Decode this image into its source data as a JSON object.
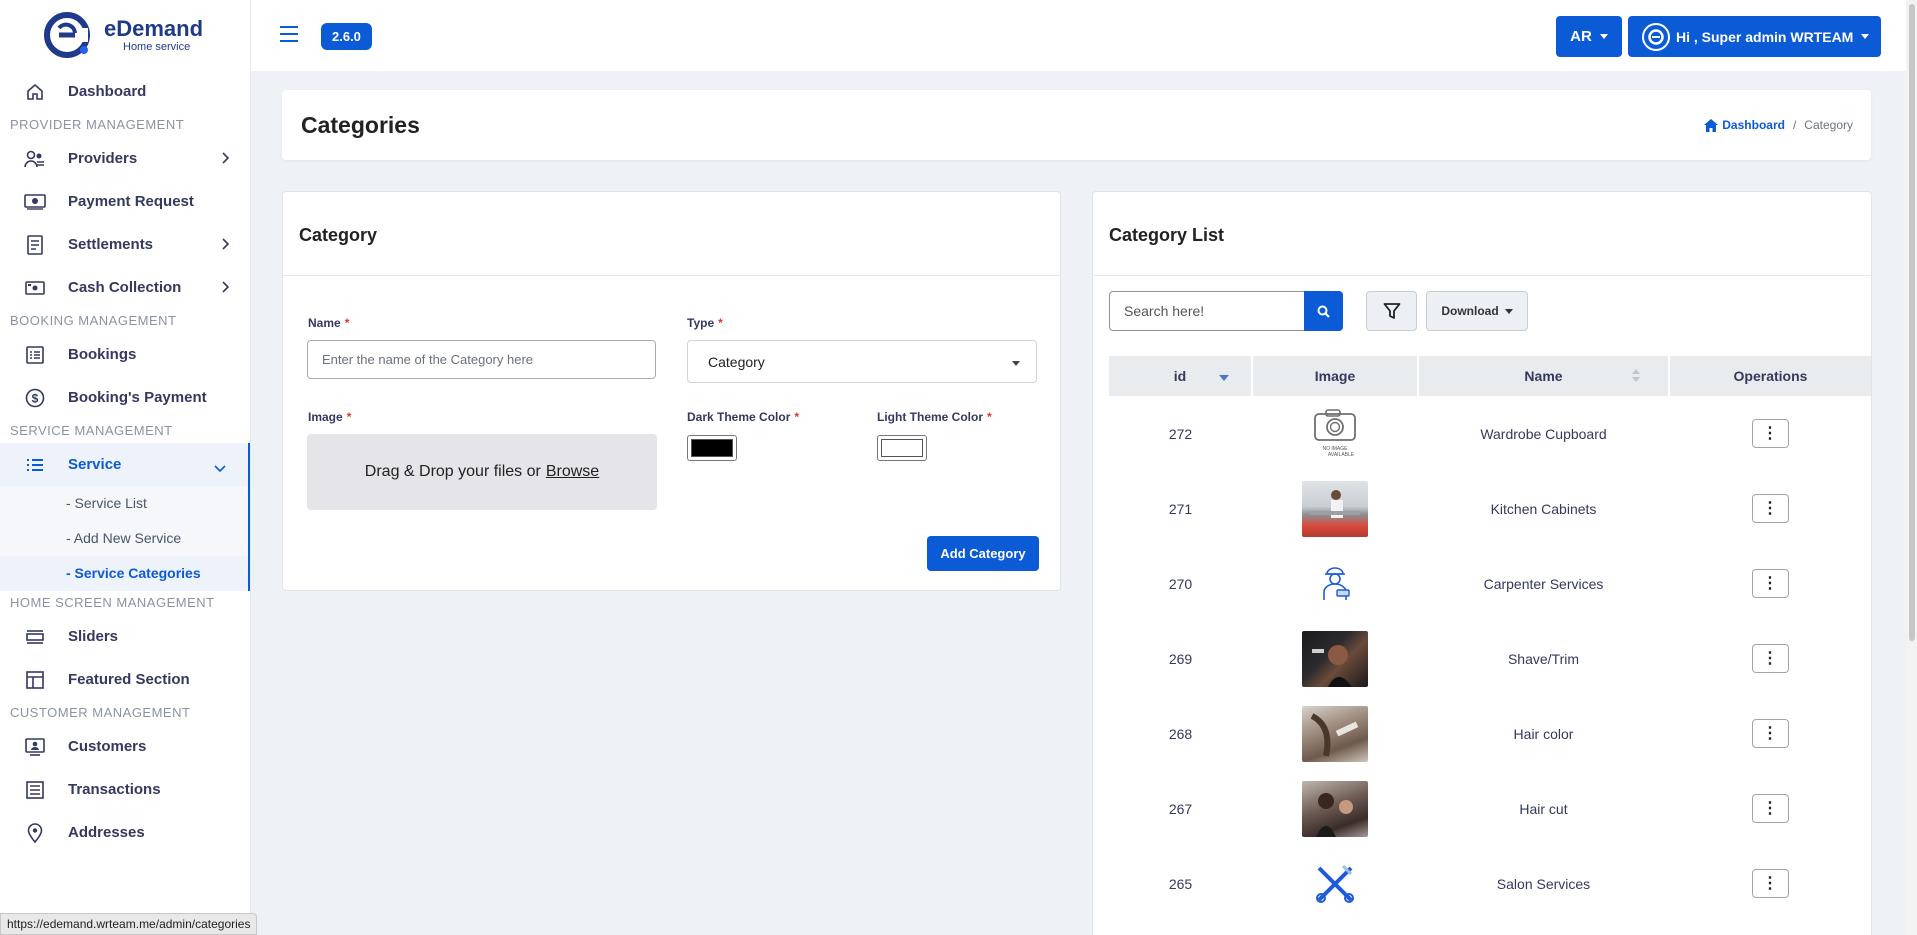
{
  "brand": {
    "title": "eDemand",
    "subtitle": "Home service"
  },
  "version": "2.6.0",
  "topbar": {
    "lang_label": "AR",
    "user_label": "Hi , Super admin WRTEAM"
  },
  "sidebar": {
    "dashboard": "Dashboard",
    "sec_provider": "PROVIDER MANAGEMENT",
    "providers": "Providers",
    "payment_request": "Payment Request",
    "settlements": "Settlements",
    "cash_collection": "Cash Collection",
    "sec_booking": "BOOKING MANAGEMENT",
    "bookings": "Bookings",
    "bookings_payment": "Booking's Payment",
    "sec_service": "SERVICE MANAGEMENT",
    "service": "Service",
    "service_list": "- Service List",
    "add_new_service": "- Add New Service",
    "service_categories": "- Service Categories",
    "sec_home": "HOME SCREEN MANAGEMENT",
    "sliders": "Sliders",
    "featured_section": "Featured Section",
    "sec_customer": "CUSTOMER MANAGEMENT",
    "customers": "Customers",
    "transactions": "Transactions",
    "addresses": "Addresses"
  },
  "page": {
    "title": "Categories",
    "breadcrumb_home": "Dashboard",
    "breadcrumb_sep": "/",
    "breadcrumb_current": "Category"
  },
  "form": {
    "card_title": "Category",
    "name_label": "Name",
    "name_placeholder": "Enter the name of the Category here",
    "name_value": "",
    "type_label": "Type",
    "type_value": "Category",
    "image_label": "Image",
    "dropzone_text": "Drag & Drop your files or",
    "dropzone_link": "Browse",
    "dark_label": "Dark Theme Color",
    "light_label": "Light Theme Color",
    "required_mark": "*",
    "submit_label": "Add Category",
    "dark_color": "#000000",
    "light_color": "#ffffff"
  },
  "list": {
    "card_title": "Category List",
    "search_placeholder": "Search here!",
    "download_label": "Download",
    "columns": [
      "id",
      "Image",
      "Name",
      "Operations"
    ],
    "rows": [
      {
        "id": "272",
        "name": "Wardrobe Cupboard",
        "image": "no-image-placeholder",
        "no_image_text_1": "NO IMAGE",
        "no_image_text_2": "AVAILABLE"
      },
      {
        "id": "271",
        "name": "Kitchen Cabinets",
        "image": "photo-kitchen"
      },
      {
        "id": "270",
        "name": "Carpenter Services",
        "image": "carpenter-icon"
      },
      {
        "id": "269",
        "name": "Shave/Trim",
        "image": "photo-shave"
      },
      {
        "id": "268",
        "name": "Hair color",
        "image": "photo-hair-color"
      },
      {
        "id": "267",
        "name": "Hair cut",
        "image": "photo-hair-cut"
      },
      {
        "id": "265",
        "name": "Salon Services",
        "image": "salon-tools-icon"
      }
    ]
  },
  "status_url": "https://edemand.wrteam.me/admin/categories",
  "colors": {
    "primary": "#0c5bd6",
    "background": "#eef1f5",
    "brand_text": "#1f3a8a"
  }
}
